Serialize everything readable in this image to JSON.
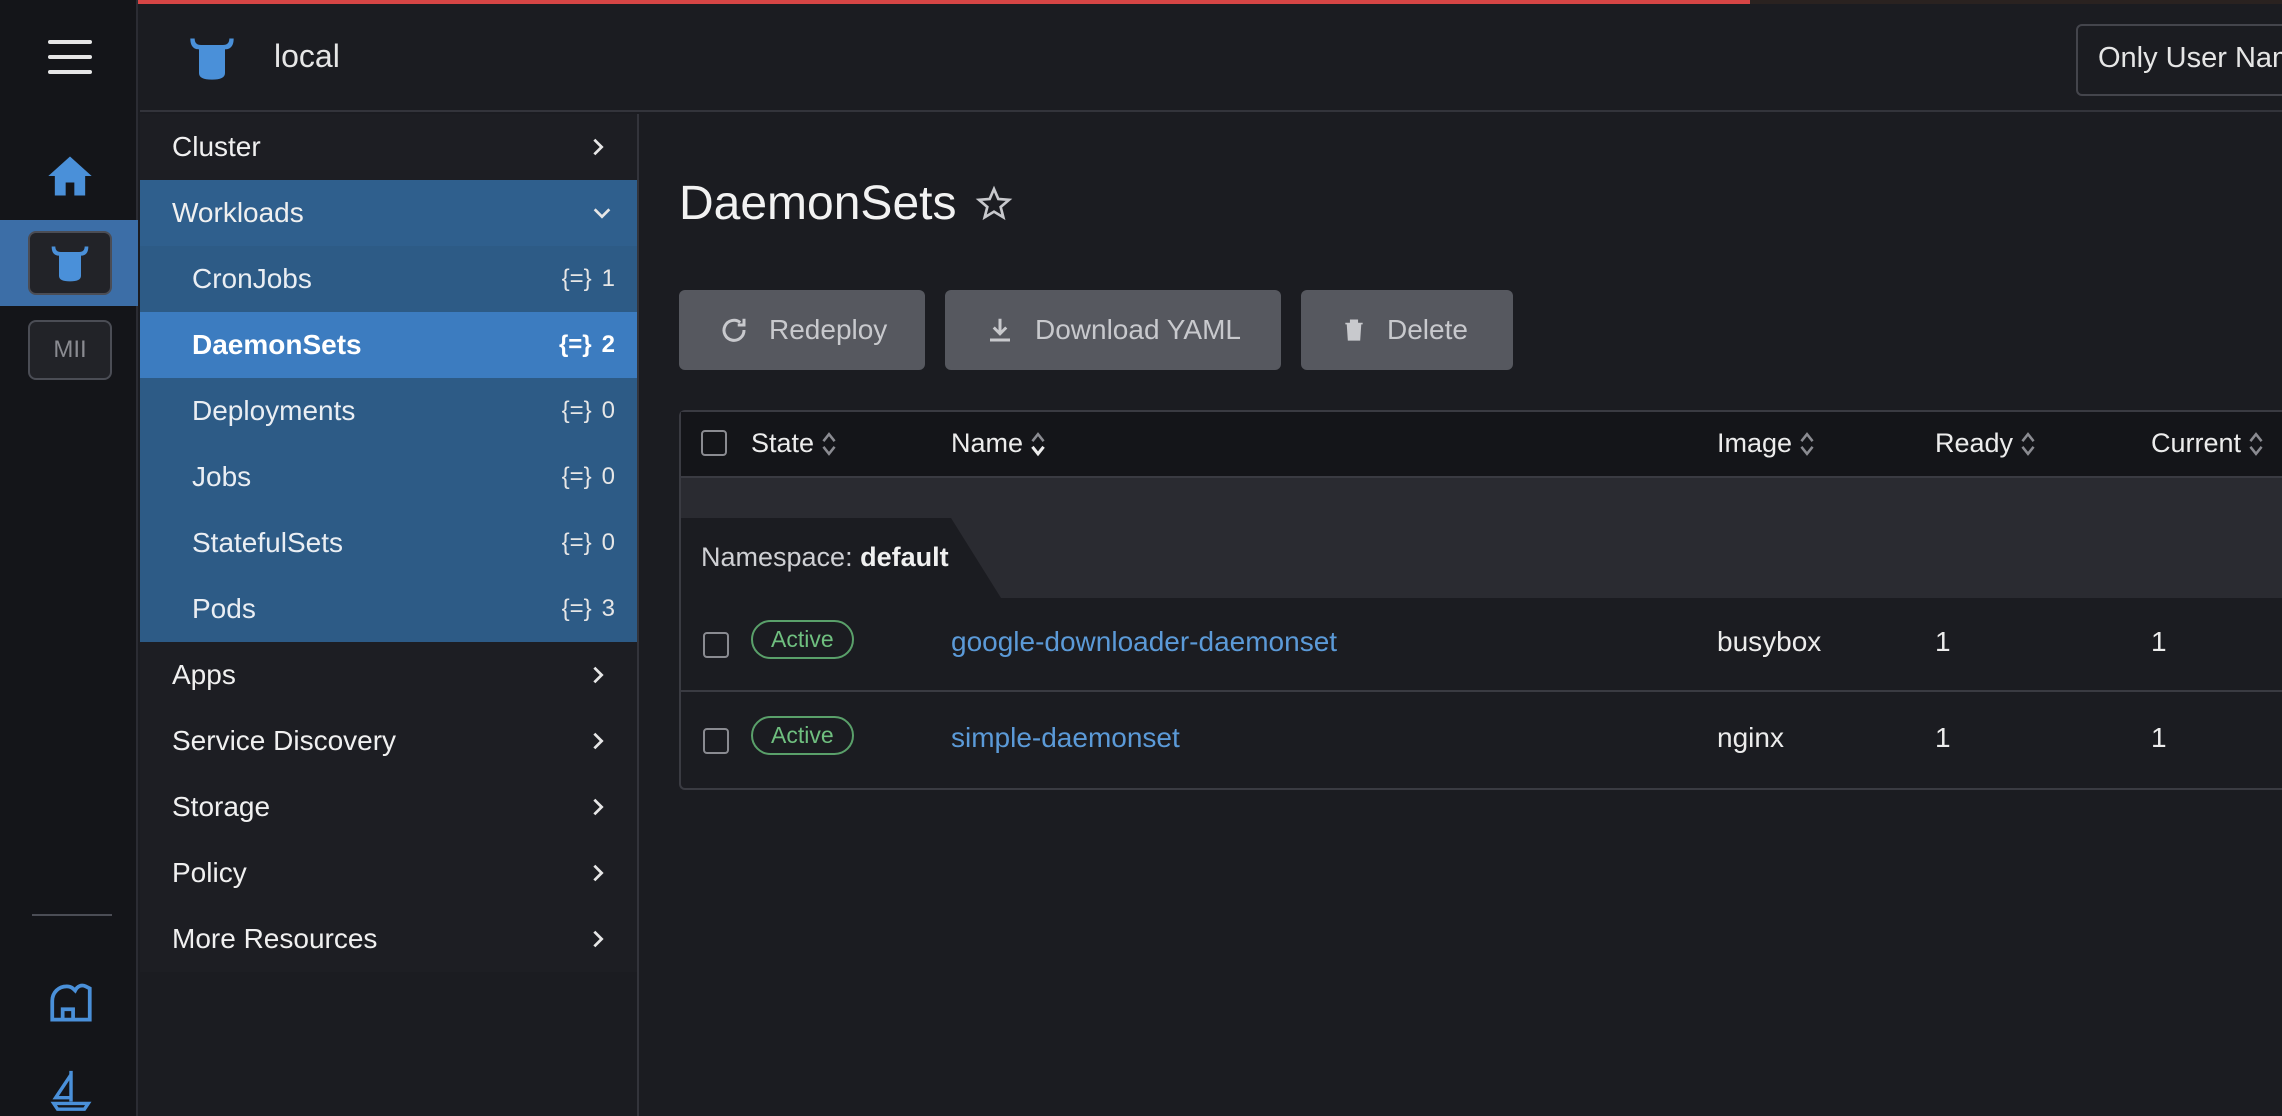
{
  "header": {
    "cluster_name": "local",
    "namespace_filter": "Only User Namespaces"
  },
  "nav": {
    "top_items": [
      {
        "label": "Cluster"
      }
    ],
    "workloads": {
      "label": "Workloads",
      "items": [
        {
          "label": "CronJobs",
          "count": "1"
        },
        {
          "label": "DaemonSets",
          "count": "2"
        },
        {
          "label": "Deployments",
          "count": "0"
        },
        {
          "label": "Jobs",
          "count": "0"
        },
        {
          "label": "StatefulSets",
          "count": "0"
        },
        {
          "label": "Pods",
          "count": "3"
        }
      ]
    },
    "bottom_items": [
      {
        "label": "Apps"
      },
      {
        "label": "Service Discovery"
      },
      {
        "label": "Storage"
      },
      {
        "label": "Policy"
      },
      {
        "label": "More Resources"
      }
    ]
  },
  "rail": {
    "mii_label": "MII"
  },
  "page": {
    "title": "DaemonSets",
    "buttons": {
      "redeploy": "Redeploy",
      "download": "Download YAML",
      "delete": "Delete"
    }
  },
  "table": {
    "columns": {
      "state": "State",
      "name": "Name",
      "image": "Image",
      "ready": "Ready",
      "current": "Current"
    },
    "group": {
      "label": "Namespace:",
      "value": "default"
    },
    "rows": [
      {
        "state": "Active",
        "name": "google-downloader-daemonset",
        "image": "busybox",
        "ready": "1",
        "current": "1"
      },
      {
        "state": "Active",
        "name": "simple-daemonset",
        "image": "nginx",
        "ready": "1",
        "current": "1"
      }
    ]
  },
  "colors": {
    "accent": "#3c7cc0",
    "group_bg": "#2d5b86",
    "active_badge": "#6fbf7f",
    "link": "#5b9ad8",
    "top_line": "#d64545"
  }
}
